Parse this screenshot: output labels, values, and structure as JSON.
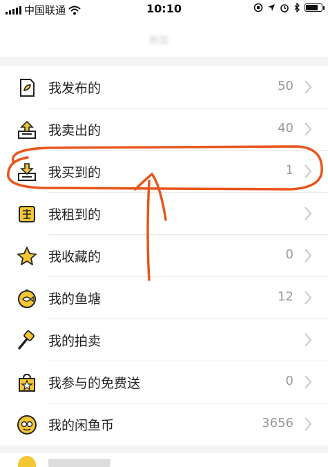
{
  "status_bar": {
    "carrier": "中国联通",
    "time": "10:10"
  },
  "header": {
    "title": "新加"
  },
  "menu": [
    {
      "label": "我发布的",
      "count": "50",
      "icon": "document-leaf-icon"
    },
    {
      "label": "我卖出的",
      "count": "40",
      "icon": "box-upload-icon"
    },
    {
      "label": "我买到的",
      "count": "1",
      "icon": "box-download-icon"
    },
    {
      "label": "我租到的",
      "count": "",
      "icon": "rent-badge-icon"
    },
    {
      "label": "我收藏的",
      "count": "0",
      "icon": "star-icon"
    },
    {
      "label": "我的鱼塘",
      "count": "12",
      "icon": "fish-pond-icon"
    },
    {
      "label": "我的拍卖",
      "count": "",
      "icon": "auction-hammer-icon"
    },
    {
      "label": "我参与的免费送",
      "count": "0",
      "icon": "gift-bag-icon"
    },
    {
      "label": "我的闲鱼币",
      "count": "3656",
      "icon": "fish-coin-icon"
    }
  ],
  "colors": {
    "accent": "#f3c633",
    "annotation": "#e8561c",
    "label": "#222222",
    "count": "#999999"
  }
}
